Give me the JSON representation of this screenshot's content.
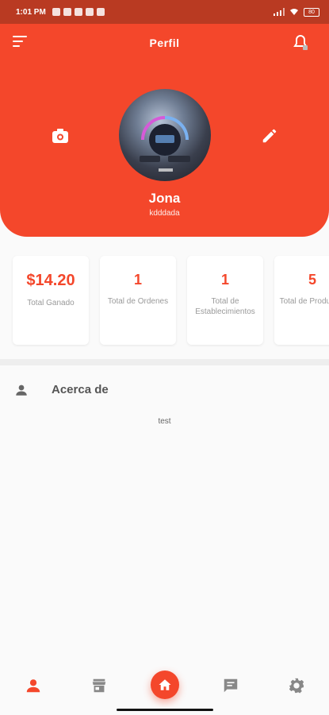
{
  "status_bar": {
    "time": "1:01 PM",
    "battery": "80"
  },
  "header": {
    "title": "Perfil",
    "name": "Jona",
    "handle": "kdddada"
  },
  "stats": [
    {
      "value": "$14.20",
      "label": "Total Ganado"
    },
    {
      "value": "1",
      "label": "Total de Ordenes"
    },
    {
      "value": "1",
      "label": "Total de Establecimientos"
    },
    {
      "value": "5",
      "label": "Total de Productos"
    }
  ],
  "about": {
    "title": "Acerca de",
    "text": "test"
  },
  "nav": {
    "items": [
      "person-icon",
      "store-icon",
      "home-icon",
      "chat-icon",
      "gear-icon"
    ],
    "active": "person-icon"
  },
  "colors": {
    "accent": "#f4472b",
    "status_bar": "#b93a22"
  }
}
